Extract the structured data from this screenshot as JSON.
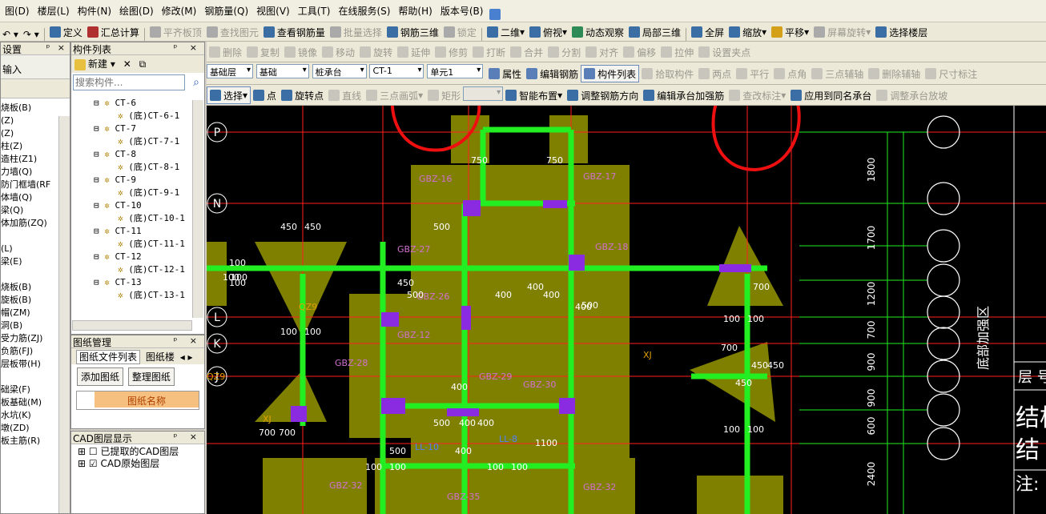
{
  "menu": [
    "图(D)",
    "楼层(L)",
    "构件(N)",
    "绘图(D)",
    "修改(M)",
    "钢筋量(Q)",
    "视图(V)",
    "工具(T)",
    "在线服务(S)",
    "帮助(H)",
    "版本号(B)"
  ],
  "toolbar1": [
    {
      "label": "定义",
      "icon": "define-icon",
      "color": "#3a6ea5",
      "dis": false
    },
    {
      "label": "汇总计算",
      "icon": "sigma-icon",
      "color": "#b03030",
      "dis": false
    },
    {
      "label": "平齐板顶",
      "icon": "align-icon",
      "color": "#aaa",
      "dis": true
    },
    {
      "label": "查找图元",
      "icon": "find-icon",
      "color": "#aaa",
      "dis": true
    },
    {
      "label": "查看钢筋量",
      "icon": "view-rebar-icon",
      "color": "#3a6ea5",
      "dis": false
    },
    {
      "label": "批量选择",
      "icon": "batch-icon",
      "color": "#aaa",
      "dis": true
    },
    {
      "label": "钢筋三维",
      "icon": "rebar-3d-icon",
      "color": "#3a6ea5",
      "dis": false
    },
    {
      "label": "锁定",
      "icon": "lock-icon",
      "color": "#aaa",
      "dis": true
    },
    {
      "label": "二维",
      "icon": "2d-icon",
      "color": "#3a6ea5",
      "dis": false
    },
    {
      "label": "俯视",
      "icon": "topview-icon",
      "color": "#3a6ea5",
      "dis": false
    },
    {
      "label": "动态观察",
      "icon": "orbit-icon",
      "color": "#2e8b57",
      "dis": false
    },
    {
      "label": "局部三维",
      "icon": "local-3d-icon",
      "color": "#3a6ea5",
      "dis": false
    },
    {
      "label": "全屏",
      "icon": "fullscreen-icon",
      "color": "#3a6ea5",
      "dis": false
    },
    {
      "label": "缩放",
      "icon": "zoom-icon",
      "color": "#3a6ea5",
      "dis": false
    },
    {
      "label": "平移",
      "icon": "pan-icon",
      "color": "#d4a017",
      "dis": false
    },
    {
      "label": "屏幕旋转",
      "icon": "rotate-screen-icon",
      "color": "#aaa",
      "dis": true
    },
    {
      "label": "选择楼层",
      "icon": "floor-icon",
      "color": "#3a6ea5",
      "dis": false
    }
  ],
  "toolbar2": [
    {
      "label": "删除",
      "dis": true
    },
    {
      "label": "复制",
      "dis": true
    },
    {
      "label": "镜像",
      "dis": true
    },
    {
      "label": "移动",
      "dis": true
    },
    {
      "label": "旋转",
      "dis": true
    },
    {
      "label": "延伸",
      "dis": true
    },
    {
      "label": "修剪",
      "dis": true
    },
    {
      "label": "打断",
      "dis": true
    },
    {
      "label": "合并",
      "dis": true
    },
    {
      "label": "分割",
      "dis": true
    },
    {
      "label": "对齐",
      "dis": true
    },
    {
      "label": "偏移",
      "dis": true
    },
    {
      "label": "拉伸",
      "dis": true
    },
    {
      "label": "设置夹点",
      "dis": true
    }
  ],
  "toolbar3": {
    "floor": "基础层",
    "type": "基础",
    "component": "桩承台",
    "name": "CT-1",
    "unit": "单元1",
    "buttons": [
      {
        "label": "属性",
        "dis": false
      },
      {
        "label": "编辑钢筋",
        "dis": false
      },
      {
        "label": "构件列表",
        "dis": false
      },
      {
        "label": "拾取构件",
        "dis": true
      },
      {
        "label": "两点",
        "dis": true
      },
      {
        "label": "平行",
        "dis": true
      },
      {
        "label": "点角",
        "dis": true
      },
      {
        "label": "三点辅轴",
        "dis": true
      },
      {
        "label": "删除辅轴",
        "dis": true
      },
      {
        "label": "尺寸标注",
        "dis": true
      }
    ]
  },
  "toolbar4": [
    {
      "label": "选择",
      "dis": false
    },
    {
      "label": "点",
      "dis": false
    },
    {
      "label": "旋转点",
      "dis": false
    },
    {
      "label": "直线",
      "dis": true
    },
    {
      "label": "三点画弧",
      "dis": true
    },
    {
      "label": "矩形",
      "dis": true
    },
    {
      "label": "智能布置",
      "dis": false
    },
    {
      "label": "调整钢筋方向",
      "dis": false
    },
    {
      "label": "编辑承台加强筋",
      "dis": false
    },
    {
      "label": "查改标注",
      "dis": true
    },
    {
      "label": "应用到同名承台",
      "dis": false
    },
    {
      "label": "调整承台放坡",
      "dis": true
    }
  ],
  "left_sidebar": {
    "title": "设置",
    "subtitle": "输入",
    "items": [
      "烧板(B)",
      "(Z)",
      "(Z)",
      "柱(Z)",
      "造柱(Z1)",
      "力墙(Q)",
      "防门框墙(RF",
      "体墙(Q)",
      "梁(Q)",
      "体加筋(ZQ)",
      "",
      "(L)",
      "梁(E)",
      "",
      "烧板(B)",
      "旋板(B)",
      "帽(ZM)",
      "洞(B)",
      "受力筋(ZJ)",
      "负筋(FJ)",
      "层板带(H)",
      "",
      "础梁(F)",
      "板基础(M)",
      "水坑(K)",
      "墩(ZD)",
      "板主筋(R)"
    ]
  },
  "component_list": {
    "title": "构件列表",
    "new_label": "新建",
    "search_placeholder": "搜索构件...",
    "items": [
      "CT-6",
      "(底)CT-6-1",
      "CT-7",
      "(底)CT-7-1",
      "CT-8",
      "(底)CT-8-1",
      "CT-9",
      "(底)CT-9-1",
      "CT-10",
      "(底)CT-10-1",
      "CT-11",
      "(底)CT-11-1",
      "CT-12",
      "(底)CT-12-1",
      "CT-13",
      "(底)CT-13-1"
    ]
  },
  "drawing_mgmt": {
    "title": "图纸管理",
    "tab1": "图纸文件列表",
    "tab2": "图纸楼",
    "add_btn": "添加图纸",
    "arrange_btn": "整理图纸",
    "col": "图纸名称"
  },
  "cad_layers": {
    "title": "CAD图层显示",
    "items": [
      "已提取的CAD图层",
      "CAD原始图层"
    ]
  },
  "canvas": {
    "axes": [
      "P",
      "N",
      "L",
      "K",
      "J"
    ],
    "dims_right": [
      "1800",
      "1700",
      "1200",
      "700",
      "900",
      "900",
      "600",
      "2400"
    ],
    "side_text": [
      "底部加强区",
      "层 号",
      "结构",
      "结",
      "注:"
    ],
    "labels": [
      {
        "t": "750",
        "c": "#fff"
      },
      {
        "t": "750",
        "c": "#fff"
      },
      {
        "t": "GBZ-16",
        "c": "#d070d0"
      },
      {
        "t": "GBZ-17",
        "c": "#d070d0"
      },
      {
        "t": "GBZ-27",
        "c": "#d070d0"
      },
      {
        "t": "GBZ-26",
        "c": "#d070d0"
      },
      {
        "t": "GBZ-12",
        "c": "#d070d0"
      },
      {
        "t": "GBZ-28",
        "c": "#d070d0"
      },
      {
        "t": "GBZ-29",
        "c": "#d070d0"
      },
      {
        "t": "GBZ-30",
        "c": "#d070d0"
      },
      {
        "t": "GBZ-18",
        "c": "#d070d0"
      },
      {
        "t": "GBZ-32",
        "c": "#d070d0"
      },
      {
        "t": "GBZ-32",
        "c": "#d070d0"
      },
      {
        "t": "GBZ-35",
        "c": "#d070d0"
      },
      {
        "t": "450",
        "c": "#fff"
      },
      {
        "t": "450",
        "c": "#fff"
      },
      {
        "t": "100",
        "c": "#fff"
      },
      {
        "t": "100",
        "c": "#fff"
      },
      {
        "t": "500",
        "c": "#fff"
      },
      {
        "t": "500",
        "c": "#fff"
      },
      {
        "t": "400",
        "c": "#fff"
      },
      {
        "t": "400",
        "c": "#fff"
      },
      {
        "t": "1100",
        "c": "#fff"
      },
      {
        "t": "500",
        "c": "#fff"
      },
      {
        "t": "500",
        "c": "#fff"
      },
      {
        "t": "400",
        "c": "#fff"
      },
      {
        "t": "100",
        "c": "#fff"
      },
      {
        "t": "100",
        "c": "#fff"
      },
      {
        "t": "100",
        "c": "#fff"
      },
      {
        "t": "100",
        "c": "#fff"
      },
      {
        "t": "700",
        "c": "#fff"
      },
      {
        "t": "700",
        "c": "#fff"
      },
      {
        "t": "100",
        "c": "#fff"
      },
      {
        "t": "100",
        "c": "#fff"
      },
      {
        "t": "450",
        "c": "#fff"
      },
      {
        "t": "450",
        "c": "#fff"
      },
      {
        "t": "100",
        "c": "#fff"
      },
      {
        "t": "100",
        "c": "#fff"
      },
      {
        "t": "LL-10",
        "c": "#5080ff"
      },
      {
        "t": "LL-8",
        "c": "#5080ff"
      },
      {
        "t": "QZ9",
        "c": "#e0a000"
      },
      {
        "t": "QZ9",
        "c": "#e0a000"
      },
      {
        "t": "XJ",
        "c": "#e0a000"
      },
      {
        "t": "XJ",
        "c": "#e0a000"
      },
      {
        "t": "700",
        "c": "#fff"
      },
      {
        "t": "700",
        "c": "#fff"
      },
      {
        "t": "400",
        "c": "#fff"
      },
      {
        "t": "400",
        "c": "#fff"
      },
      {
        "t": "450",
        "c": "#fff"
      },
      {
        "t": "450",
        "c": "#fff"
      },
      {
        "t": "500",
        "c": "#fff"
      },
      {
        "t": "100",
        "c": "#fff"
      },
      {
        "t": "100",
        "c": "#fff"
      },
      {
        "t": "400",
        "c": "#fff"
      },
      {
        "t": "400",
        "c": "#fff"
      },
      {
        "t": "400",
        "c": "#fff"
      },
      {
        "t": "100",
        "c": "#fff"
      },
      {
        "t": "100",
        "c": "#fff"
      },
      {
        "t": "100",
        "c": "#fff"
      }
    ]
  }
}
